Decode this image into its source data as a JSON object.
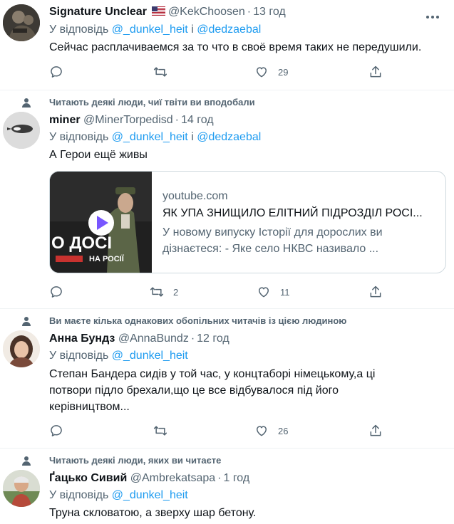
{
  "colors": {
    "link": "#1d9bf0",
    "secondary": "#536471",
    "divider": "#eff3f4"
  },
  "tweets": [
    {
      "name": "Signature Unclear",
      "flag": "US",
      "handle": "@KekChoosen",
      "time": "13 год",
      "reply_prefix": "У відповідь",
      "reply_to_1": "@_dunkel_heit",
      "reply_and": "і",
      "reply_to_2": "@dedzaebal",
      "text": "Сейчас расплачиваемся за то что в своё время таких не передушили.",
      "replies": "",
      "retweets": "",
      "likes": "29"
    },
    {
      "context": "Читають деякі люди, чиї твіти ви вподобали",
      "name": "miner",
      "handle": "@MinerTorpedisd",
      "time": "14 год",
      "reply_prefix": "У відповідь",
      "reply_to_1": "@_dunkel_heit",
      "reply_and": "і",
      "reply_to_2": "@dedzaebal",
      "text": "А Герои ещё живы",
      "card": {
        "domain": "youtube.com",
        "title": "ЯК УПА ЗНИЩИЛО ЕЛІТНИЙ ПІДРОЗДІЛ РОСІ...",
        "description": "У новому випуску Історії для дорослих ви дізнаєтеся: - Яке село НКВС називало ...",
        "thumb_line1": "О ДОСІ",
        "thumb_line2": "НА РОСІЇ"
      },
      "replies": "",
      "retweets": "2",
      "likes": "11"
    },
    {
      "context": "Ви маєте кілька однакових обопільних читачів із цією людиною",
      "name": "Анна Бундз",
      "handle": "@AnnaBundz",
      "time": "12 год",
      "reply_prefix": "У відповідь",
      "reply_to_1": "@_dunkel_heit",
      "text": "Степан Бандера сидів у той час, у концтаборі німецькому,а ці потвори підло брехали,що це все відбувалося під його керівництвом...",
      "replies": "",
      "retweets": "",
      "likes": "26"
    },
    {
      "context": "Читають деякі люди, яких ви читаєте",
      "name": "Ґацько Сивий",
      "handle": "@Ambrekatsapa",
      "time": "1 год",
      "reply_prefix": "У відповідь",
      "reply_to_1": "@_dunkel_heit",
      "text": "Труна скловатою, а зверху шар бетону."
    }
  ]
}
